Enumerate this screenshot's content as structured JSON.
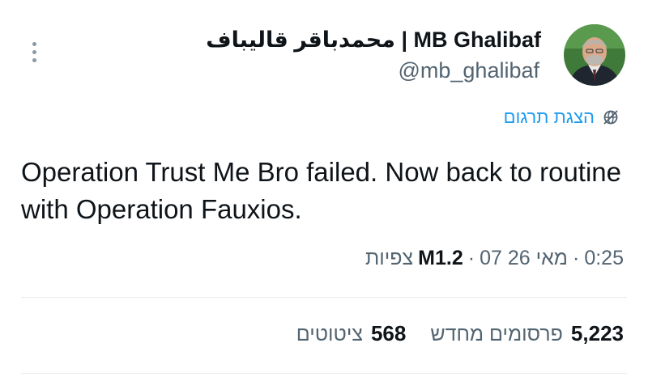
{
  "author": {
    "display_name": "محمدباقر قالیباف | MB Ghalibaf",
    "handle": "@mb_ghalibaf"
  },
  "translate": {
    "label": "הצגת תרגום",
    "icon": "globe-slash-icon"
  },
  "tweet": {
    "text": "Operation Trust Me Bro failed. Now back to routine with Operation Fauxios."
  },
  "meta": {
    "time": "0:25",
    "date": "07 מאי 26",
    "separator": "·",
    "views_count": "M1.2",
    "views_label": "צפיות"
  },
  "stats": [
    {
      "count": "5,223",
      "label": "פרסומים מחדש"
    },
    {
      "count": "568",
      "label": "ציטוטים"
    }
  ],
  "colors": {
    "text_primary": "#0f1419",
    "text_secondary": "#536471",
    "link": "#1d9bf0",
    "divider": "#e6ecf0"
  }
}
